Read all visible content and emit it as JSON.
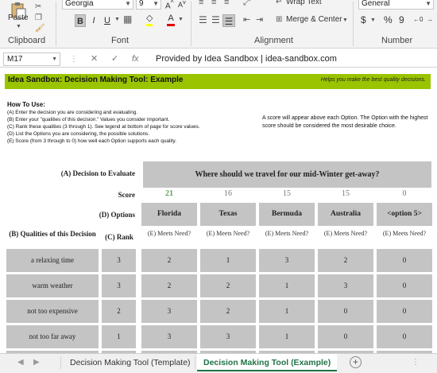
{
  "ribbon": {
    "paste_label": "Paste",
    "clipboard_label": "Clipboard",
    "font_label": "Font",
    "alignment_label": "Alignment",
    "number_label": "Number",
    "font_name": "Georgia",
    "font_size": "9",
    "bold": "B",
    "italic": "I",
    "underline": "U",
    "font_color_glyph": "A",
    "wrap_text": "Wrap Text",
    "merge_center": "Merge & Center",
    "number_format": "General",
    "currency": "$",
    "percent": "%",
    "comma": "9"
  },
  "formula_bar": {
    "name_box": "M17",
    "formula": "Provided by Idea Sandbox | idea-sandbox.com",
    "cancel": "✕",
    "enter": "✓",
    "fx": "fx"
  },
  "sheet": {
    "title": "Idea Sandbox: Decision Making Tool: Example",
    "tagline": "Helps you make the best quality decisions.",
    "howto_heading": "How To Use:",
    "howto_lines": [
      "(A) Enter the decision you are considering and evaluating.",
      "(B) Enter your \"qualities of this decision.\" Values you consider important.",
      "(C) Rank these qualities (3 through 1). See legend at bottom of page for score values.",
      "(D) List the Options you are considering, the possible solutions.",
      "(E) Score (from 3 through to 0) how well each Option supports each quality."
    ],
    "note": "A score will appear above each Option. The Option with the highest score should be considered the most desirable choice.",
    "decision_label": "(A) Decision to Evaluate",
    "decision_value": "Where should we travel for our mid-Winter get-away?",
    "score_label": "Score",
    "options_label": "(D) Options",
    "qualities_label": "(B) Qualities of this Decision",
    "rank_label": "(C) Rank",
    "meets_label": "(E) Meets Need?",
    "options": [
      {
        "name": "Florida",
        "score": "21"
      },
      {
        "name": "Texas",
        "score": "16"
      },
      {
        "name": "Bermuda",
        "score": "15"
      },
      {
        "name": "Australia",
        "score": "15"
      },
      {
        "name": "<option 5>",
        "score": "0"
      }
    ],
    "rows": [
      {
        "quality": "a relaxing time",
        "rank": "3",
        "values": [
          "2",
          "1",
          "3",
          "2",
          "0"
        ]
      },
      {
        "quality": "warm weather",
        "rank": "3",
        "values": [
          "2",
          "2",
          "1",
          "3",
          "0"
        ]
      },
      {
        "quality": "not too expensive",
        "rank": "2",
        "values": [
          "3",
          "2",
          "1",
          "0",
          "0"
        ]
      },
      {
        "quality": "not too far away",
        "rank": "1",
        "values": [
          "3",
          "3",
          "1",
          "0",
          "0"
        ]
      }
    ]
  },
  "tabs": [
    {
      "label": "Decision Making Tool (Template)"
    },
    {
      "label": "Decision Making Tool (Example)"
    }
  ],
  "colors": {
    "title_bar": "#9ac400",
    "cell_gray": "#c4c4c4",
    "top_score": "#5aa05a",
    "active_tab": "#217346"
  }
}
